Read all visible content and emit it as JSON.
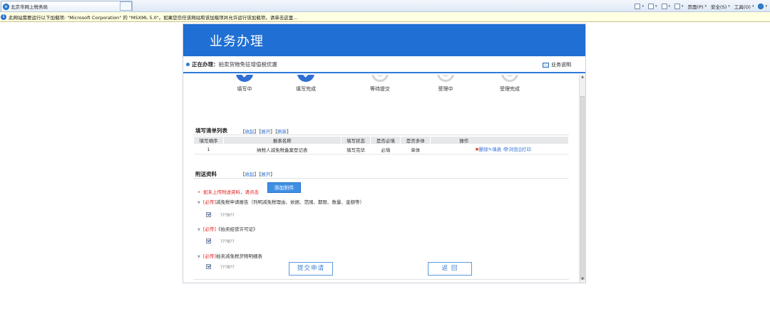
{
  "browser": {
    "tab_title": "北京市网上税务局",
    "commands": [
      "页面(P)",
      "安全(S)",
      "工具(O)"
    ],
    "infobar_text": "此网站需要运行以下加载项: \"Microsoft Corporation\" 的 \"MSXML 5.0\"。如果您信任该网站和该加载项并允许运行该加载项，请单击这里..."
  },
  "banner": {
    "title": "业务办理"
  },
  "processing": {
    "label": "正在办理：",
    "value": "拍卖货物免征增值税优惠",
    "help": "业务说明"
  },
  "steps": [
    {
      "label": "填写中",
      "state": "done"
    },
    {
      "label": "填写完成",
      "state": "done"
    },
    {
      "label": "等待提交",
      "state": "pending"
    },
    {
      "label": "受理中",
      "state": "pending"
    },
    {
      "label": "受理完成",
      "state": "pending"
    }
  ],
  "fill_list": {
    "title": "填写清单列表",
    "collapse": "收起",
    "expand": "展开",
    "refresh": "刷新",
    "headers": [
      "填写顺序",
      "报表名称",
      "填写状态",
      "是否必填",
      "是否多体",
      "操作"
    ],
    "rows": [
      {
        "order": "1",
        "name": "纳税人减免税备案登记表",
        "status": "填写完毕",
        "required": "必填",
        "multi": "单体",
        "ops": {
          "delete": "删除",
          "fill": "填表",
          "view": "浏览",
          "print": "打印"
        }
      }
    ]
  },
  "attachments": {
    "title": "附送资料",
    "collapse": "收起",
    "expand": "展开",
    "note": "如未上传附送资料，请点击",
    "add_button": "添加附件",
    "required_tag": "[必传]",
    "items": [
      {
        "name": "减免税申请报告（列明减免税理由、依据、范围、期限、数量、金额等）",
        "file": "???8??"
      },
      {
        "name": "《拍卖经营许可证》",
        "file": "???8??"
      },
      {
        "name": "拍卖减免税货物明细表",
        "file": "???8??"
      }
    ]
  },
  "buttons": {
    "submit": "提交申请",
    "back": "返  回"
  }
}
